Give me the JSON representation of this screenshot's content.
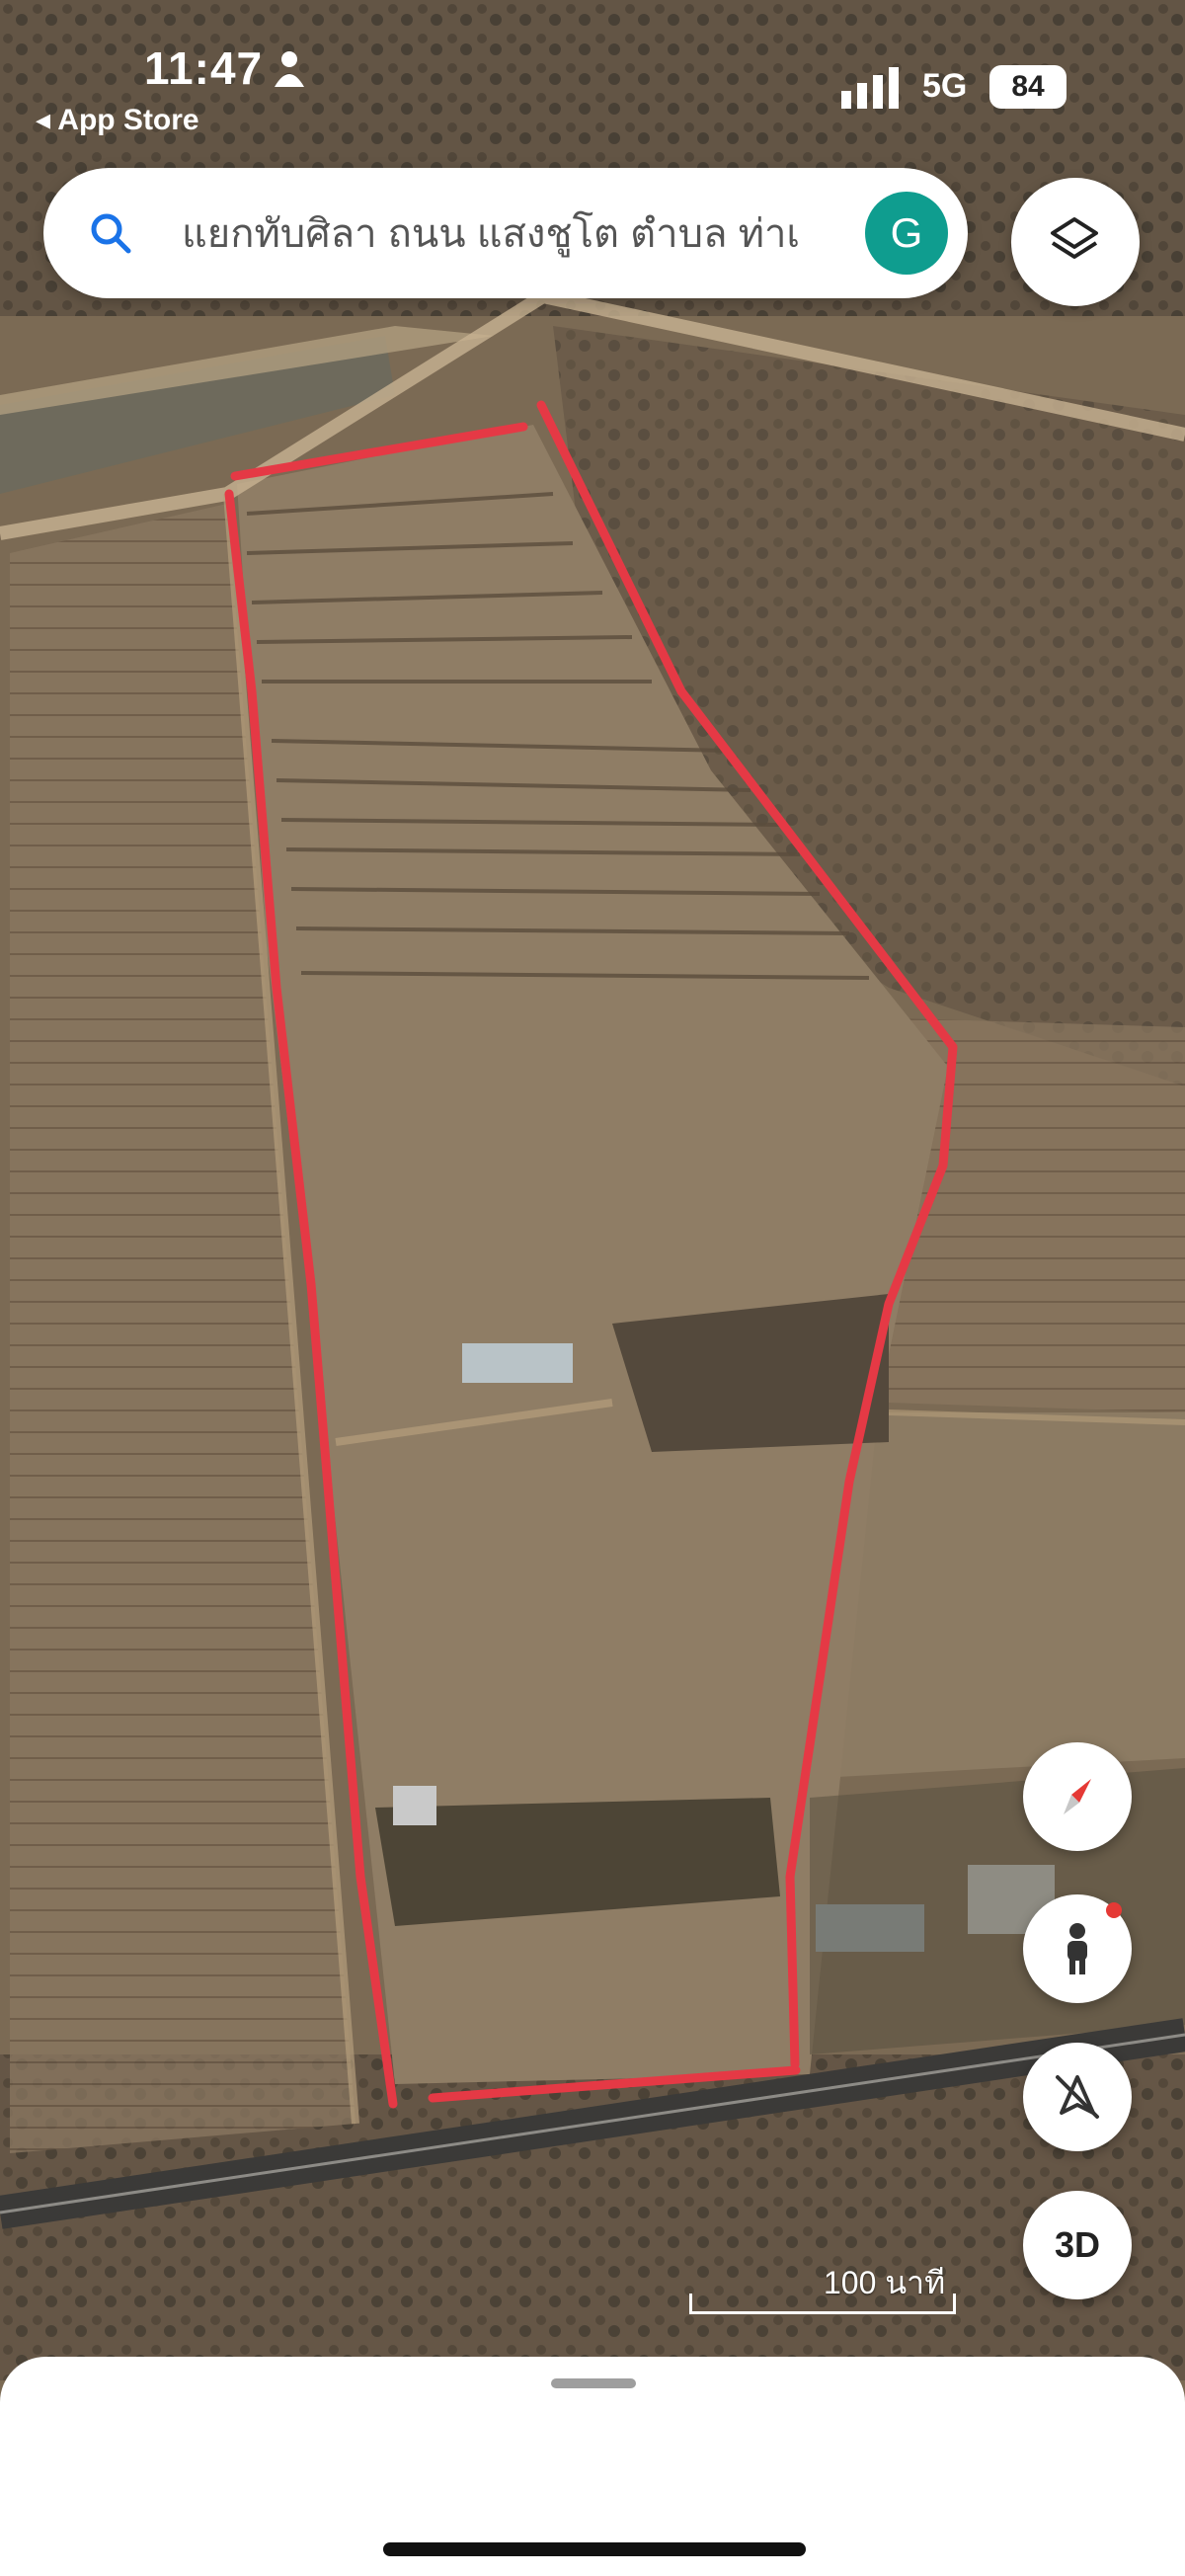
{
  "status_bar": {
    "time": "11:47",
    "back_app": "◂ App Store",
    "network": "5G",
    "battery": "84"
  },
  "search": {
    "query": "แยกทับศิลา ถนน แสงชูโต ตำบล ท่าเ",
    "avatar_letter": "G"
  },
  "map": {
    "scale_label": "100 นาที",
    "boundary_color": "#e53945",
    "view_type": "satellite"
  },
  "controls": {
    "three_d_label": "3D",
    "icons": [
      "layers-icon",
      "compass-icon",
      "pegman-icon",
      "location-off-icon"
    ]
  }
}
